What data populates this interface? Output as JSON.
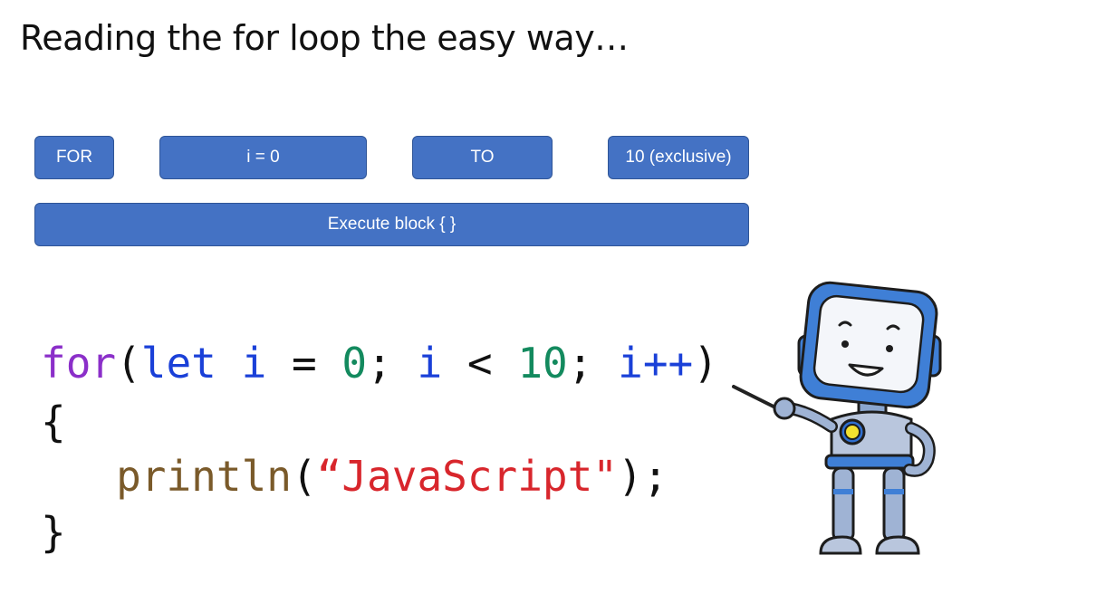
{
  "slide": {
    "title": "Reading the for loop the easy way…"
  },
  "boxes": {
    "for": "FOR",
    "init": "i = 0",
    "to": "TO",
    "limit": "10 (exclusive)",
    "execute": "Execute block {  }"
  },
  "code": {
    "line1": {
      "kw_for": "for",
      "paren_open": "(",
      "kw_let": "let",
      "var1": "i",
      "eq": "=",
      "zero": "0",
      "semi1": ";",
      "var2": "i",
      "lt": "<",
      "ten": "10",
      "semi2": ";",
      "incr": "i++",
      "paren_close": ")"
    },
    "brace_open": "{",
    "line3": {
      "fn": "println",
      "paren_open": "(",
      "string": "“JavaScript\"",
      "close": ");"
    },
    "brace_close": "}"
  },
  "colors": {
    "box_fill": "#4472c4",
    "keyword_for": "#8b2fc9",
    "keyword_let": "#1a40d8",
    "number": "#138a5e",
    "function": "#7a5a2a",
    "string": "#d8262c"
  },
  "illustration": {
    "icon": "robot-teacher-pointer-icon"
  }
}
